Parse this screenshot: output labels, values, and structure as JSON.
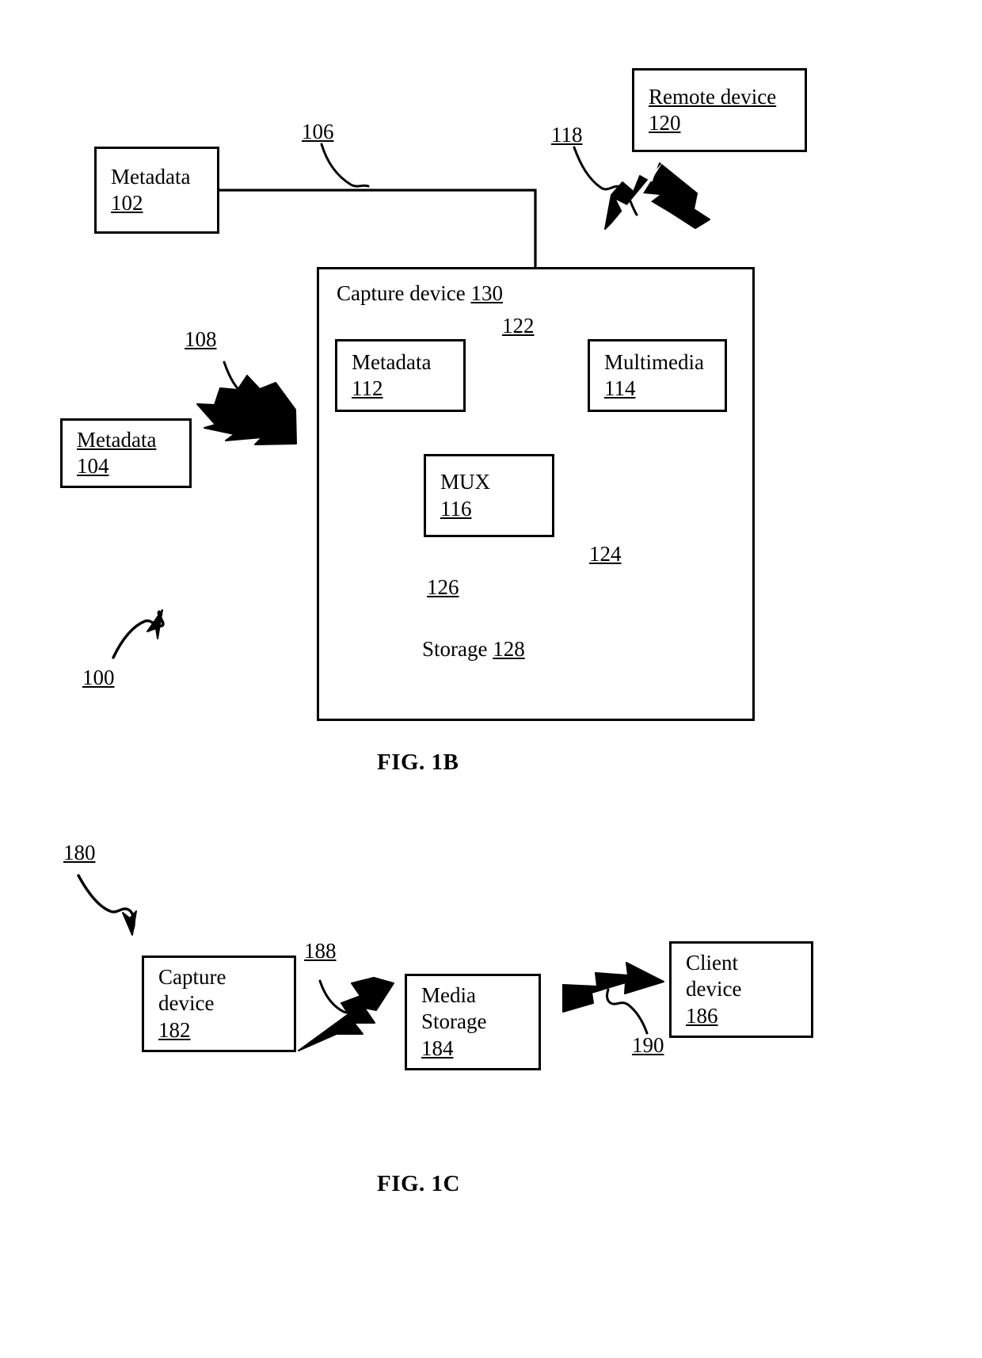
{
  "figures": [
    {
      "id": "fig1b",
      "caption": "FIG. 1B",
      "system_ref": "100"
    },
    {
      "id": "fig1c",
      "caption": "FIG. 1C",
      "system_ref": "180"
    }
  ],
  "fig1b": {
    "caption": "FIG. 1B",
    "system_ref": "100",
    "metadata_102": {
      "label": "Metadata",
      "ref": "102"
    },
    "metadata_104": {
      "label": "Metadata",
      "ref": "104"
    },
    "remote_device_120": {
      "label": "Remote device",
      "ref": "120"
    },
    "capture_device_130": {
      "label": "Capture device",
      "ref": "130"
    },
    "metadata_112": {
      "label": "Metadata",
      "ref": "112"
    },
    "multimedia_114": {
      "label": "Multimedia",
      "ref": "114"
    },
    "mux_116": {
      "label": "MUX",
      "ref": "116"
    },
    "storage_128": {
      "label": "Storage",
      "ref": "128"
    },
    "link_106": "106",
    "link_108": "108",
    "link_118": "118",
    "link_122": "122",
    "link_124": "124",
    "link_126": "126"
  },
  "fig1c": {
    "caption": "FIG. 1C",
    "system_ref": "180",
    "capture_device_182": {
      "label_line1": "Capture",
      "label_line2": "device",
      "ref": "182"
    },
    "media_storage_184": {
      "label_line1": "Media",
      "label_line2": "Storage",
      "ref": "184"
    },
    "client_device_186": {
      "label_line1": "Client",
      "label_line2": "device",
      "ref": "186"
    },
    "link_188": "188",
    "link_190": "190"
  },
  "colors": {
    "stroke": "#000000",
    "background": "#ffffff"
  }
}
